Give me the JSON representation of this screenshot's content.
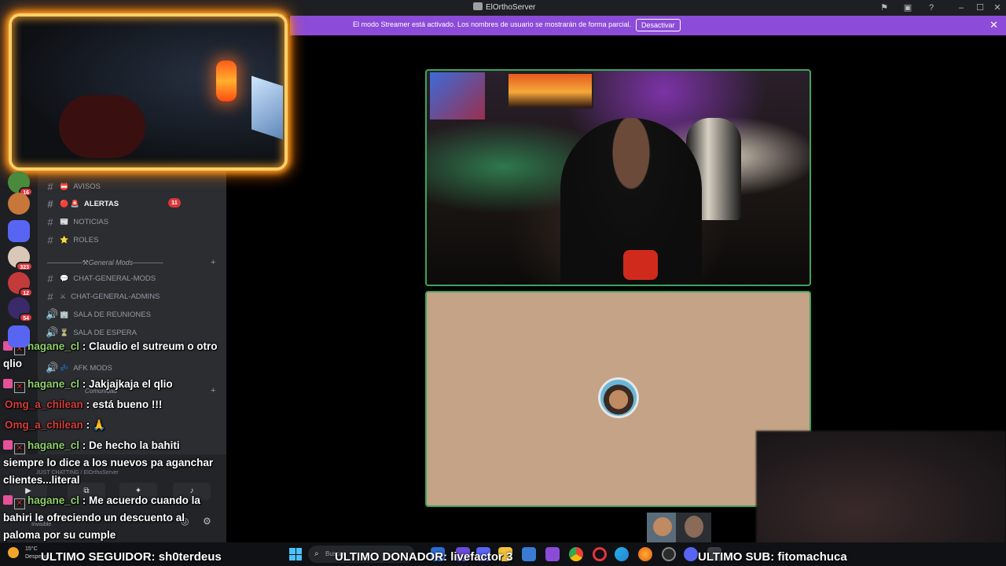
{
  "window": {
    "title": "ElOrthoServer"
  },
  "banner": {
    "text": "El modo Streamer está activado. Los nombres de usuario se mostrarán de forma parcial.",
    "button_label": "Desactivar",
    "close_glyph": "✕",
    "color": "#8c4bd8"
  },
  "servers": [
    {
      "badge": "16",
      "color": "#4a8a3c"
    },
    {
      "badge": "",
      "color": "#c7773a"
    },
    {
      "badge": "",
      "color": "#5865f2"
    },
    {
      "badge": "323",
      "color": "#d9c8b8"
    },
    {
      "badge": "12",
      "color": "#c43a3a"
    },
    {
      "badge": "54",
      "color": "#3a2a6a"
    },
    {
      "badge": "",
      "color": "#5865f2"
    }
  ],
  "channels": {
    "items": [
      {
        "icon": "#",
        "emoji": "📛",
        "label": "AVISOS",
        "active": false
      },
      {
        "icon": "#",
        "emoji": "🔴 🚨",
        "label": "ALERTAS",
        "active": true
      },
      {
        "icon": "#",
        "emoji": "📰",
        "label": "NOTICIAS",
        "active": false
      },
      {
        "icon": "#",
        "emoji": "⭐",
        "label": "ROLES",
        "active": false
      },
      {
        "icon": "#",
        "emoji": "💬",
        "label": "CHAT-GENERAL-MODS",
        "active": false
      },
      {
        "icon": "#",
        "emoji": "⚔",
        "label": "CHAT-GENERAL-ADMINS",
        "active": false
      },
      {
        "icon": "🔊",
        "emoji": "🏢",
        "label": "SALA DE REUNIONES",
        "active": false
      },
      {
        "icon": "🔊",
        "emoji": "⏳",
        "label": "SALA DE ESPERA",
        "active": false
      },
      {
        "icon": "🔊",
        "emoji": "💤",
        "label": "AFK MODS",
        "active": false
      }
    ],
    "alert_badge": "11",
    "category_mods": "───────⚒General Mods──────",
    "category_community": "Comunidad",
    "plus": "+"
  },
  "voice_panel": {
    "subtitle": "JUST CHATTING / ElOrthoServer",
    "status": "Invisible"
  },
  "chat": {
    "messages": [
      {
        "user": "hagane_cl",
        "text": ": Claudio el sutreum o otro qlio"
      },
      {
        "user": "hagane_cl",
        "text": ": Jakjajkaja el qlio"
      },
      {
        "user": "Omg_a_chilean",
        "text": ": está bueno !!!"
      },
      {
        "user": "Omg_a_chilean",
        "text": ": 🙏"
      },
      {
        "user": "hagane_cl",
        "text": ": De hecho la bahiti siempre lo dice a los nuevos pa aganchar clientes...literal"
      },
      {
        "user": "hagane_cl",
        "text": ": Me acuerdo cuando la bahiri le ofreciendo un descuento al paloma por su cumple"
      }
    ]
  },
  "taskbar": {
    "temp": "15°C",
    "weather_desc": "Despejado",
    "search_placeholder": "Buscar"
  },
  "ticker": {
    "follower": "ULTIMO SEGUIDOR: sh0terdeus",
    "donor": "ULTIMO DONADOR: livefactor  3",
    "sub": "ULTIMO SUB: fitomachuca"
  }
}
